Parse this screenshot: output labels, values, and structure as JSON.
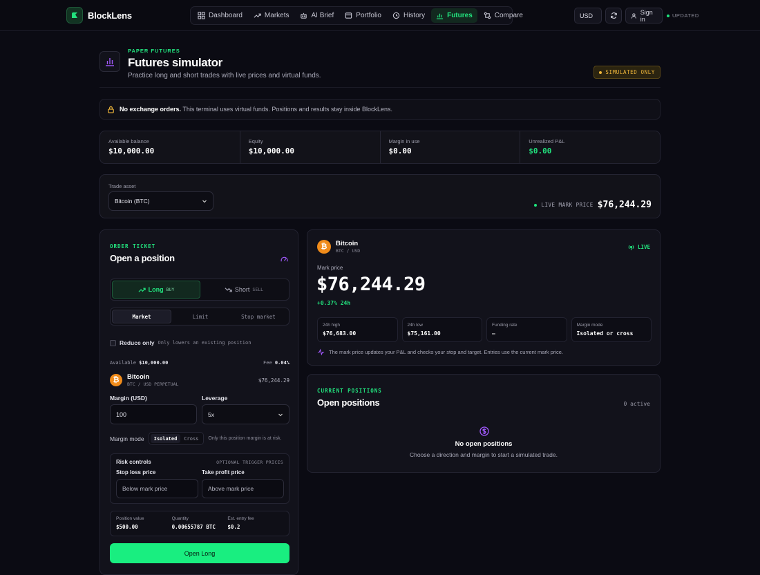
{
  "brand": {
    "name": "BlockLens"
  },
  "nav": {
    "items": [
      {
        "label": "Dashboard",
        "icon": "dashboard-icon"
      },
      {
        "label": "Markets",
        "icon": "trending-icon"
      },
      {
        "label": "AI Brief",
        "icon": "robot-icon"
      },
      {
        "label": "Portfolio",
        "icon": "wallet-icon"
      },
      {
        "label": "History",
        "icon": "history-icon"
      },
      {
        "label": "Futures",
        "icon": "chart-icon",
        "active": true
      },
      {
        "label": "Compare",
        "icon": "compare-icon"
      }
    ]
  },
  "topbar": {
    "currency": "USD",
    "signin": "Sign in",
    "updated": "UPDATED"
  },
  "header": {
    "eyebrow": "PAPER FUTURES",
    "title": "Futures simulator",
    "subtitle": "Practice long and short trades with live prices and virtual funds.",
    "badge": "SIMULATED ONLY"
  },
  "notice": {
    "bold": "No exchange orders.",
    "text": "This terminal uses virtual funds. Positions and results stay inside BlockLens."
  },
  "stats": [
    {
      "label": "Available balance",
      "value": "$10,000.00"
    },
    {
      "label": "Equity",
      "value": "$10,000.00"
    },
    {
      "label": "Margin in use",
      "value": "$0.00"
    },
    {
      "label": "Unrealized P&L",
      "value": "$0.00"
    }
  ],
  "asset": {
    "label": "Trade asset",
    "selected": "Bitcoin (BTC)",
    "live_label": "LIVE MARK PRICE",
    "live_price": "$76,244.29"
  },
  "ticket": {
    "eyebrow": "ORDER TICKET",
    "title": "Open a position",
    "long": "Long",
    "long_sub": "BUY",
    "short": "Short",
    "short_sub": "SELL",
    "order_types": [
      "Market",
      "Limit",
      "Stop market"
    ],
    "reduce_only": "Reduce only",
    "reduce_note": "Only lowers an existing position",
    "available_label": "Available",
    "available_value": "$10,000.00",
    "fee_label": "Fee",
    "fee_value": "0.04%",
    "asset_name": "Bitcoin",
    "asset_pair": "BTC / USD PERPETUAL",
    "asset_price": "$76,244.29",
    "margin_label": "Margin (USD)",
    "margin_value": "100",
    "leverage_label": "Leverage",
    "leverage_value": "5x",
    "margin_mode_label": "Margin mode",
    "mode_isolated": "Isolated",
    "mode_cross": "Cross",
    "mode_note": "Only this position margin is at risk.",
    "risk_title": "Risk controls",
    "risk_note": "OPTIONAL TRIGGER PRICES",
    "sl_label": "Stop loss price",
    "sl_placeholder": "Below mark price",
    "tp_label": "Take profit price",
    "tp_placeholder": "Above mark price",
    "summary": [
      {
        "label": "Position value",
        "value": "$500.00"
      },
      {
        "label": "Quantity",
        "value": "0.00655787 BTC"
      },
      {
        "label": "Est. entry fee",
        "value": "$0.2"
      }
    ],
    "submit": "Open Long"
  },
  "market": {
    "name": "Bitcoin",
    "pair": "BTC / USD",
    "live": "LIVE",
    "mark_label": "Mark price",
    "mark_price": "$76,244.29",
    "change": "+0.37% 24h",
    "boxes": [
      {
        "label": "24h high",
        "value": "$76,683.00"
      },
      {
        "label": "24h low",
        "value": "$75,161.00"
      },
      {
        "label": "Funding rate",
        "value": "—"
      },
      {
        "label": "Margin mode",
        "value": "Isolated or cross"
      }
    ],
    "note": "The mark price updates your P&L and checks your stop and target. Entries use the current mark price."
  },
  "positions": {
    "eyebrow": "CURRENT POSITIONS",
    "title": "Open positions",
    "count": "0 active",
    "empty_title": "No open positions",
    "empty_text": "Choose a direction and margin to start a simulated trade."
  },
  "colors": {
    "accent": "#22e37e",
    "warning": "#f0b73a",
    "btc": "#f08b1a",
    "purple": "#a259ff"
  }
}
